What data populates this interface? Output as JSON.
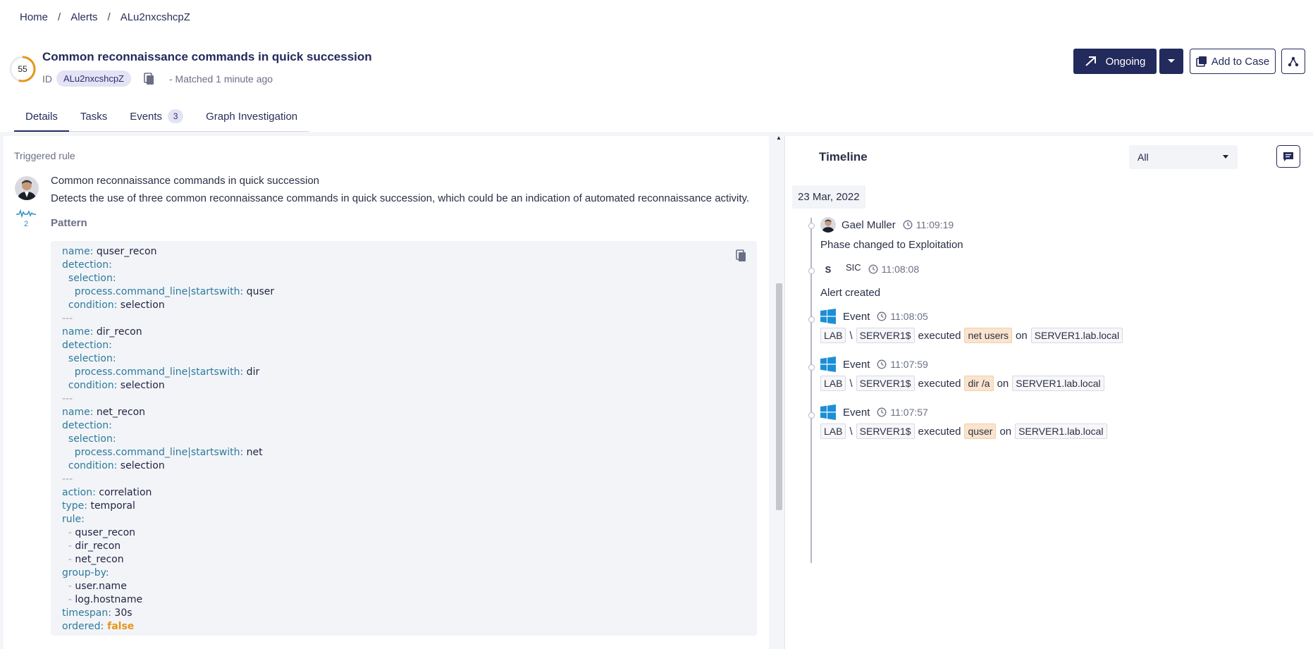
{
  "breadcrumb": {
    "home": "Home",
    "alerts": "Alerts",
    "current": "ALu2nxcshcpZ",
    "sep": "/"
  },
  "alert": {
    "score": "55",
    "score_fraction": 0.55,
    "title": "Common reconnaissance commands in quick succession",
    "id_label": "ID",
    "id_value": "ALu2nxcshcpZ",
    "matched": "- Matched 1 minute ago"
  },
  "actions": {
    "ongoing": "Ongoing",
    "add_to_case": "Add to Case"
  },
  "tabs": [
    {
      "label": "Details"
    },
    {
      "label": "Tasks"
    },
    {
      "label": "Events",
      "count": "3"
    },
    {
      "label": "Graph Investigation"
    }
  ],
  "details": {
    "section": "Triggered rule",
    "rule_name": "Common reconnaissance commands in quick succession",
    "rule_desc": "Detects the use of three common reconnaissance commands in quick succession, which could be an indication of automated reconnaissance activity.",
    "spark_count": "2",
    "pattern_label": "Pattern",
    "pattern_lines": [
      [
        {
          "t": "name:",
          "c": "k"
        },
        {
          "t": " quser_recon",
          "c": "v"
        }
      ],
      [
        {
          "t": "detection:",
          "c": "k"
        }
      ],
      [
        {
          "t": "  selection:",
          "c": "k"
        }
      ],
      [
        {
          "t": "    process.command_line|startswith:",
          "c": "k"
        },
        {
          "t": " quser",
          "c": "v"
        }
      ],
      [
        {
          "t": "  condition:",
          "c": "k"
        },
        {
          "t": " selection",
          "c": "v"
        }
      ],
      [
        {
          "t": "---",
          "c": "d"
        }
      ],
      [
        {
          "t": "name:",
          "c": "k"
        },
        {
          "t": " dir_recon",
          "c": "v"
        }
      ],
      [
        {
          "t": "detection:",
          "c": "k"
        }
      ],
      [
        {
          "t": "  selection:",
          "c": "k"
        }
      ],
      [
        {
          "t": "    process.command_line|startswith:",
          "c": "k"
        },
        {
          "t": " dir",
          "c": "v"
        }
      ],
      [
        {
          "t": "  condition:",
          "c": "k"
        },
        {
          "t": " selection",
          "c": "v"
        }
      ],
      [
        {
          "t": "---",
          "c": "d"
        }
      ],
      [
        {
          "t": "name:",
          "c": "k"
        },
        {
          "t": " net_recon",
          "c": "v"
        }
      ],
      [
        {
          "t": "detection:",
          "c": "k"
        }
      ],
      [
        {
          "t": "  selection:",
          "c": "k"
        }
      ],
      [
        {
          "t": "    process.command_line|startswith:",
          "c": "k"
        },
        {
          "t": " net",
          "c": "v"
        }
      ],
      [
        {
          "t": "  condition:",
          "c": "k"
        },
        {
          "t": " selection",
          "c": "v"
        }
      ],
      [
        {
          "t": "---",
          "c": "d"
        }
      ],
      [
        {
          "t": "action:",
          "c": "k"
        },
        {
          "t": " correlation",
          "c": "v"
        }
      ],
      [
        {
          "t": "type:",
          "c": "k"
        },
        {
          "t": " temporal",
          "c": "v"
        }
      ],
      [
        {
          "t": "rule:",
          "c": "k"
        }
      ],
      [
        {
          "t": "  - ",
          "c": "d"
        },
        {
          "t": "quser_recon",
          "c": "v"
        }
      ],
      [
        {
          "t": "  - ",
          "c": "d"
        },
        {
          "t": "dir_recon",
          "c": "v"
        }
      ],
      [
        {
          "t": "  - ",
          "c": "d"
        },
        {
          "t": "net_recon",
          "c": "v"
        }
      ],
      [
        {
          "t": "group-by:",
          "c": "k"
        }
      ],
      [
        {
          "t": "  - ",
          "c": "d"
        },
        {
          "t": "user.name",
          "c": "v"
        }
      ],
      [
        {
          "t": "  - ",
          "c": "d"
        },
        {
          "t": "log.hostname",
          "c": "v"
        }
      ],
      [
        {
          "t": "timespan:",
          "c": "k"
        },
        {
          "t": " 30s",
          "c": "v"
        }
      ],
      [
        {
          "t": "ordered:",
          "c": "k"
        },
        {
          "t": " false",
          "c": "f"
        }
      ]
    ]
  },
  "timeline": {
    "title": "Timeline",
    "filter": "All",
    "date": "23 Mar, 2022",
    "phase": {
      "user": "Gael Muller",
      "time": "11:09:19",
      "text": "Phase changed to Exploitation"
    },
    "created": {
      "mark": "S",
      "user": "SIC",
      "time": "11:08:08",
      "text": "Alert created"
    },
    "events": [
      {
        "label": "Event",
        "time": "11:08:05",
        "domain": "LAB",
        "sep": "\\",
        "user": "SERVER1$",
        "verb": "executed",
        "cmd": "net users",
        "on": "on",
        "host": "SERVER1.lab.local"
      },
      {
        "label": "Event",
        "time": "11:07:59",
        "domain": "LAB",
        "sep": "\\",
        "user": "SERVER1$",
        "verb": "executed",
        "cmd": "dir /a",
        "on": "on",
        "host": "SERVER1.lab.local"
      },
      {
        "label": "Event",
        "time": "11:07:57",
        "domain": "LAB",
        "sep": "\\",
        "user": "SERVER1$",
        "verb": "executed",
        "cmd": "quser",
        "on": "on",
        "host": "SERVER1.lab.local"
      }
    ]
  },
  "colors": {
    "primary": "#232a5c",
    "score_ring": "#e8951a",
    "keyword": "#2b7b9b",
    "highlight": "#fbe4cd"
  },
  "icons": [
    "copy-icon",
    "arrow-up-right-icon",
    "caret-down-icon",
    "add-to-case-icon",
    "graph-icon",
    "comment-icon",
    "clock-icon",
    "windows-icon"
  ]
}
